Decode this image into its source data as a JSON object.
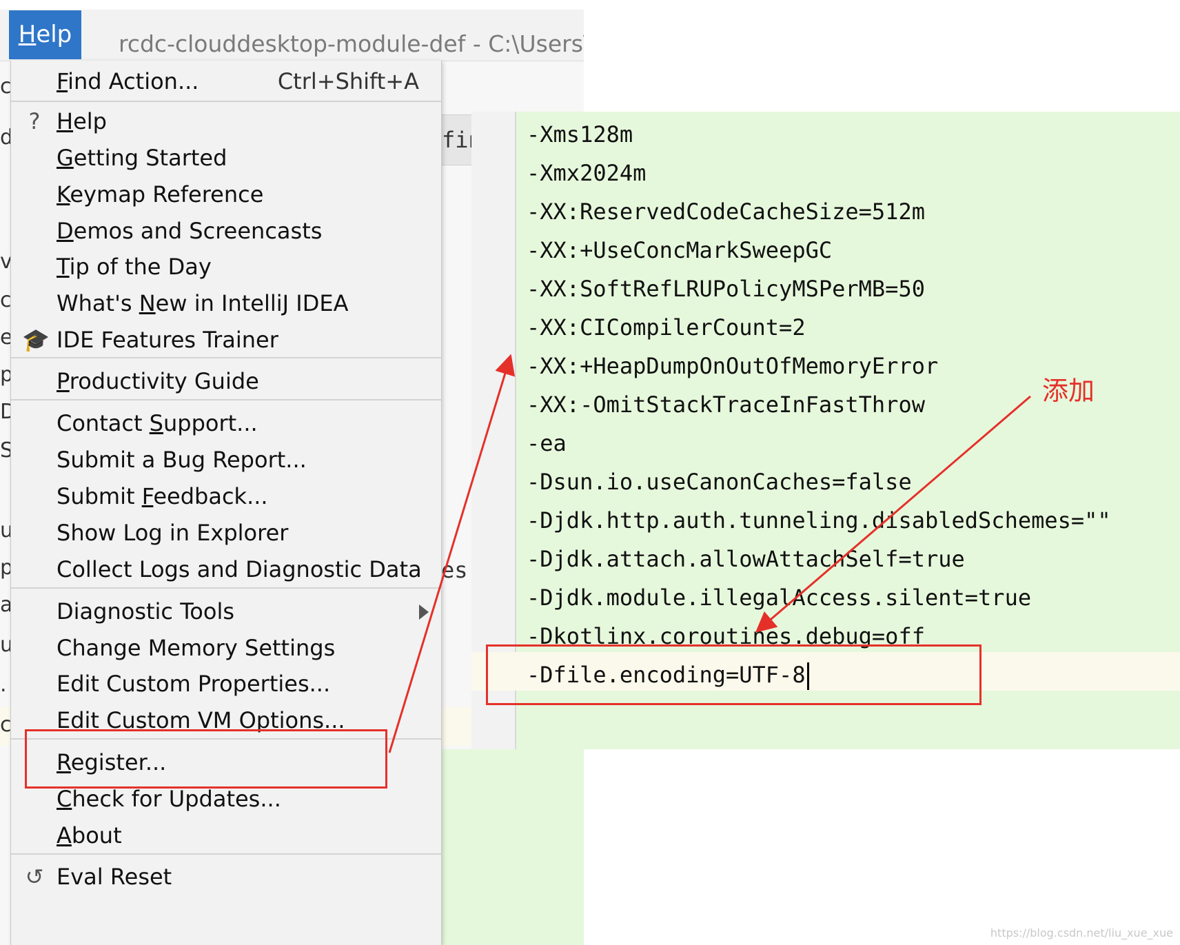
{
  "window": {
    "menu_button": {
      "label": "Help",
      "mnemonic_index": 0
    },
    "title": "rcdc-clouddesktop-module-def - C:\\Users\\liu"
  },
  "background": {
    "left_edge_chars": [
      "c",
      "d",
      "v",
      "c",
      "e",
      "p",
      "D",
      "S",
      "u",
      "p",
      "a",
      "u",
      ".",
      "c"
    ],
    "tab_fragment": "finit",
    "es_fragment": "es"
  },
  "help_menu": {
    "items": [
      {
        "label_before": "",
        "mnemonic": "F",
        "label_after": "ind Action...",
        "shortcut": "Ctrl+Shift+A",
        "icon": ""
      },
      {
        "label_before": "",
        "mnemonic": "H",
        "label_after": "elp",
        "shortcut": "",
        "icon": "question-icon",
        "icon_glyph": "?"
      },
      {
        "label_before": "",
        "mnemonic": "G",
        "label_after": "etting Started",
        "shortcut": "",
        "icon": ""
      },
      {
        "label_before": "",
        "mnemonic": "K",
        "label_after": "eymap Reference",
        "shortcut": "",
        "icon": ""
      },
      {
        "label_before": "",
        "mnemonic": "D",
        "label_after": "emos and Screencasts",
        "shortcut": "",
        "icon": ""
      },
      {
        "label_before": "",
        "mnemonic": "T",
        "label_after": "ip of the Day",
        "shortcut": "",
        "icon": ""
      },
      {
        "label_before": "What's ",
        "mnemonic": "N",
        "label_after": "ew in IntelliJ IDEA",
        "shortcut": "",
        "icon": ""
      },
      {
        "label_before": "IDE Features Trainer",
        "mnemonic": "",
        "label_after": "",
        "shortcut": "",
        "icon": "graduation-cap-icon",
        "icon_glyph": "🎓"
      },
      {
        "label_before": "",
        "mnemonic": "P",
        "label_after": "roductivity Guide",
        "shortcut": "",
        "icon": ""
      },
      {
        "label_before": "Contact ",
        "mnemonic": "S",
        "label_after": "upport...",
        "shortcut": "",
        "icon": ""
      },
      {
        "label_before": "Submit a Bug Report...",
        "mnemonic": "",
        "label_after": "",
        "shortcut": "",
        "icon": ""
      },
      {
        "label_before": "Submit ",
        "mnemonic": "F",
        "label_after": "eedback...",
        "shortcut": "",
        "icon": ""
      },
      {
        "label_before": "Show Log in Explorer",
        "mnemonic": "",
        "label_after": "",
        "shortcut": "",
        "icon": ""
      },
      {
        "label_before": "Collect Logs and Diagnostic Data",
        "mnemonic": "",
        "label_after": "",
        "shortcut": "",
        "icon": ""
      },
      {
        "label_before": "Diagnostic Tools",
        "mnemonic": "",
        "label_after": "",
        "shortcut": "",
        "icon": "",
        "submenu": true
      },
      {
        "label_before": "Change Memory Settings",
        "mnemonic": "",
        "label_after": "",
        "shortcut": "",
        "icon": ""
      },
      {
        "label_before": "Edit Custom Properties...",
        "mnemonic": "",
        "label_after": "",
        "shortcut": "",
        "icon": ""
      },
      {
        "label_before": "Edit Custom VM Options...",
        "mnemonic": "",
        "label_after": "",
        "shortcut": "",
        "icon": "",
        "highlighted": true
      },
      {
        "label_before": "",
        "mnemonic": "R",
        "label_after": "egister...",
        "shortcut": "",
        "icon": ""
      },
      {
        "label_before": "",
        "mnemonic": "C",
        "label_after": "heck for Updates...",
        "shortcut": "",
        "icon": ""
      },
      {
        "label_before": "",
        "mnemonic": "A",
        "label_after": "bout",
        "shortcut": "",
        "icon": ""
      },
      {
        "label_before": "Eval Reset",
        "mnemonic": "",
        "label_after": "",
        "shortcut": "",
        "icon": "undo-icon",
        "icon_glyph": "↺"
      }
    ]
  },
  "editor": {
    "lines": [
      "-Xms128m",
      "-Xmx2024m",
      "-XX:ReservedCodeCacheSize=512m",
      "-XX:+UseConcMarkSweepGC",
      "-XX:SoftRefLRUPolicyMSPerMB=50",
      "-XX:CICompilerCount=2",
      "-XX:+HeapDumpOnOutOfMemoryError",
      "-XX:-OmitStackTraceInFastThrow",
      "-ea",
      "-Dsun.io.useCanonCaches=false",
      "-Djdk.http.auth.tunneling.disabledSchemes=\"\"",
      "-Djdk.attach.allowAttachSelf=true",
      "-Djdk.module.illegalAccess.silent=true",
      "-Dkotlinx.coroutines.debug=off",
      "-Dfile.encoding=UTF-8"
    ],
    "current_line_index": 14,
    "background_color": "#e6f8dc"
  },
  "annotation": {
    "label": "添加",
    "color": "#e5302a"
  },
  "watermark": "https://blog.csdn.net/liu_xue_xue",
  "colors": {
    "menu_button_bg": "#2f76c9",
    "menu_bg": "#f2f2f2",
    "highlight_red": "#e5302a"
  }
}
